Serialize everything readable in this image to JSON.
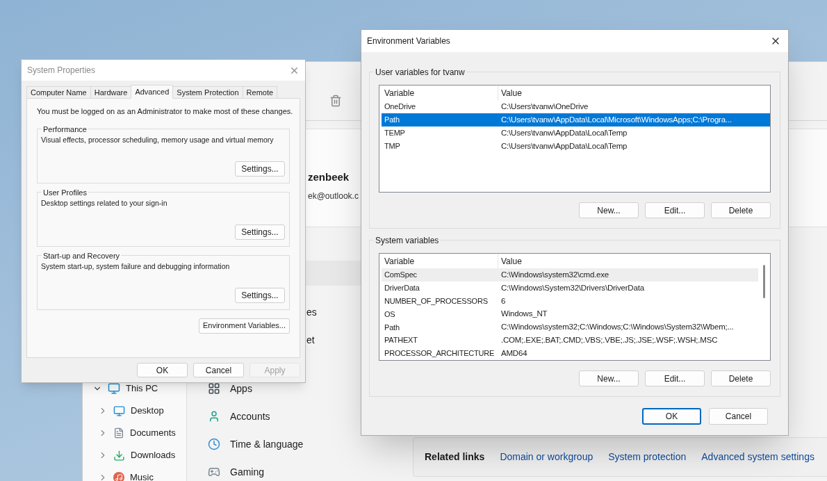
{
  "explorer": {
    "tree": [
      {
        "label": "This PC",
        "kind": "pc",
        "expanded": true,
        "children": [
          {
            "label": "Desktop",
            "kind": "desktop",
            "expanded": false
          },
          {
            "label": "Documents",
            "kind": "documents",
            "expanded": false
          },
          {
            "label": "Downloads",
            "kind": "downloads",
            "expanded": false
          },
          {
            "label": "Music",
            "kind": "music",
            "expanded": false
          }
        ]
      }
    ]
  },
  "settings": {
    "account_name": "zenbeek",
    "account_email": "ek@outlook.c",
    "nav_items_upper": [
      {
        "label": "es"
      },
      {
        "label": "et"
      }
    ],
    "nav_items_lower": [
      {
        "label": "Apps",
        "kind": "apps"
      },
      {
        "label": "Accounts",
        "kind": "accounts"
      },
      {
        "label": "Time & language",
        "kind": "time"
      },
      {
        "label": "Gaming",
        "kind": "gaming"
      }
    ],
    "related_links": {
      "title": "Related links",
      "links": [
        "Domain or workgroup",
        "System protection",
        "Advanced system settings"
      ]
    }
  },
  "system_properties": {
    "title": "System Properties",
    "active": false,
    "tabs": [
      {
        "label": "Computer Name",
        "selected": false
      },
      {
        "label": "Hardware",
        "selected": false
      },
      {
        "label": "Advanced",
        "selected": true
      },
      {
        "label": "System Protection",
        "selected": false
      },
      {
        "label": "Remote",
        "selected": false
      }
    ],
    "notice": "You must be logged on as an Administrator to make most of these changes.",
    "groups": [
      {
        "title": "Performance",
        "description": "Visual effects, processor scheduling, memory usage and virtual memory",
        "button": "Settings..."
      },
      {
        "title": "User Profiles",
        "description": "Desktop settings related to your sign-in",
        "button": "Settings..."
      },
      {
        "title": "Start-up and Recovery",
        "description": "System start-up, system failure and debugging information",
        "button": "Settings..."
      }
    ],
    "env_button": "Environment Variables...",
    "buttons": [
      {
        "label": "OK",
        "disabled": false
      },
      {
        "label": "Cancel",
        "disabled": false
      },
      {
        "label": "Apply",
        "disabled": true
      }
    ]
  },
  "environment_variables": {
    "title": "Environment Variables",
    "sections": [
      {
        "title": "User variables for tvanw",
        "focused": true,
        "scrollbar": false,
        "columns": [
          "Variable",
          "Value"
        ],
        "rows": [
          {
            "variable": "OneDrive",
            "value": "C:\\Users\\tvanw\\OneDrive",
            "selected": false
          },
          {
            "variable": "Path",
            "value": "C:\\Users\\tvanw\\AppData\\Local\\Microsoft\\WindowsApps;C:\\Progra...",
            "selected": true
          },
          {
            "variable": "TEMP",
            "value": "C:\\Users\\tvanw\\AppData\\Local\\Temp",
            "selected": false
          },
          {
            "variable": "TMP",
            "value": "C:\\Users\\tvanw\\AppData\\Local\\Temp",
            "selected": false
          }
        ],
        "buttons": [
          "New...",
          "Edit...",
          "Delete"
        ]
      },
      {
        "title": "System variables",
        "focused": false,
        "scrollbar": true,
        "columns": [
          "Variable",
          "Value"
        ],
        "rows": [
          {
            "variable": "ComSpec",
            "value": "C:\\Windows\\system32\\cmd.exe",
            "selected": true
          },
          {
            "variable": "DriverData",
            "value": "C:\\Windows\\System32\\Drivers\\DriverData",
            "selected": false
          },
          {
            "variable": "NUMBER_OF_PROCESSORS",
            "value": "6",
            "selected": false
          },
          {
            "variable": "OS",
            "value": "Windows_NT",
            "selected": false
          },
          {
            "variable": "Path",
            "value": "C:\\Windows\\system32;C:\\Windows;C:\\Windows\\System32\\Wbem;...",
            "selected": false
          },
          {
            "variable": "PATHEXT",
            "value": ".COM;.EXE;.BAT;.CMD;.VBS;.VBE;.JS;.JSE;.WSF;.WSH;.MSC",
            "selected": false
          },
          {
            "variable": "PROCESSOR_ARCHITECTURE",
            "value": "AMD64",
            "selected": false
          }
        ],
        "buttons": [
          "New...",
          "Edit...",
          "Delete"
        ]
      }
    ],
    "buttons": [
      {
        "label": "OK",
        "default": true
      },
      {
        "label": "Cancel",
        "default": false
      }
    ]
  }
}
